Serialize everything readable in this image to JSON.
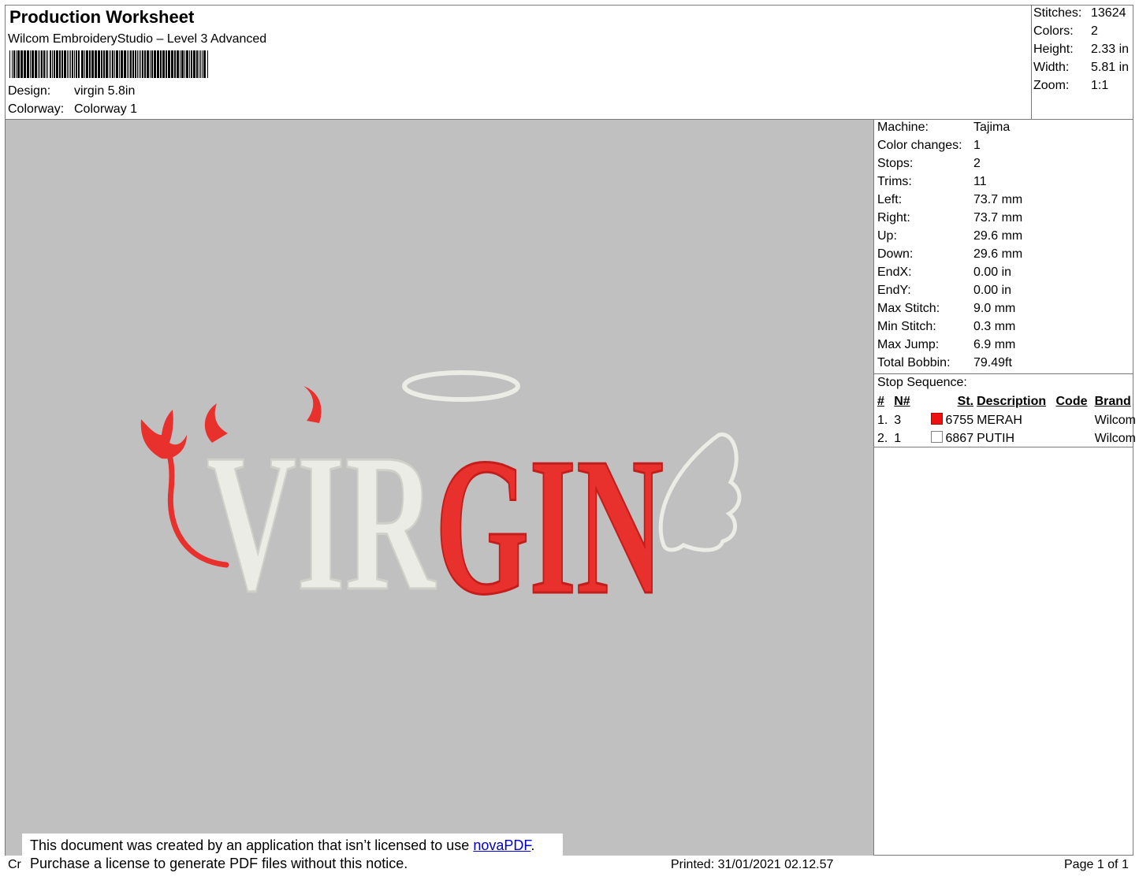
{
  "header": {
    "title": "Production Worksheet",
    "software": "Wilcom EmbroideryStudio – Level 3 Advanced",
    "design_label": "Design:",
    "design_value": "virgin 5.8in",
    "colorway_label": "Colorway:",
    "colorway_value": "Colorway 1"
  },
  "summary": [
    {
      "label": "Stitches:",
      "value": "13624"
    },
    {
      "label": "Colors:",
      "value": "2"
    },
    {
      "label": "Height:",
      "value": "2.33 in"
    },
    {
      "label": "Width:",
      "value": "5.81 in"
    },
    {
      "label": "Zoom:",
      "value": "1:1"
    }
  ],
  "details": [
    {
      "label": "Machine:",
      "value": "Tajima"
    },
    {
      "label": "Color changes:",
      "value": "1"
    },
    {
      "label": "Stops:",
      "value": "2"
    },
    {
      "label": "Trims:",
      "value": "11"
    },
    {
      "label": "Left:",
      "value": "73.7 mm"
    },
    {
      "label": "Right:",
      "value": "73.7 mm"
    },
    {
      "label": "Up:",
      "value": "29.6 mm"
    },
    {
      "label": "Down:",
      "value": "29.6 mm"
    },
    {
      "label": "EndX:",
      "value": "0.00 in"
    },
    {
      "label": "EndY:",
      "value": "0.00 in"
    },
    {
      "label": "Max Stitch:",
      "value": "9.0 mm"
    },
    {
      "label": "Min Stitch:",
      "value": "0.3 mm"
    },
    {
      "label": "Max Jump:",
      "value": "6.9 mm"
    },
    {
      "label": "Total Bobbin:",
      "value": "79.49ft"
    }
  ],
  "stop_sequence": {
    "label": "Stop Sequence:",
    "columns": [
      "#",
      "N#",
      "St.",
      "Description",
      "Code",
      "Brand"
    ],
    "rows": [
      {
        "num": "1.",
        "n": "3",
        "color": "#ee1111",
        "st": "6755",
        "desc": "MERAH",
        "code": "",
        "brand": "Wilcom"
      },
      {
        "num": "2.",
        "n": "1",
        "color": "#ffffff",
        "st": "6867",
        "desc": "PUTIH",
        "code": "",
        "brand": "Wilcom"
      }
    ]
  },
  "design_art": {
    "text_white": "VIR",
    "text_red": "GIN",
    "colors": {
      "red": "#e8302c",
      "white": "#ecece6",
      "background": "#c0c0c0"
    }
  },
  "notice": {
    "line1_pre": "This document was created by an application that isn’t licensed to use ",
    "link": "novaPDF",
    "line1_post": ".",
    "line2": "Purchase a license to generate PDF files without this notice."
  },
  "footer": {
    "left": "Cr",
    "printed": "Printed: 31/01/2021 02.12.57",
    "page": "Page 1 of 1"
  }
}
